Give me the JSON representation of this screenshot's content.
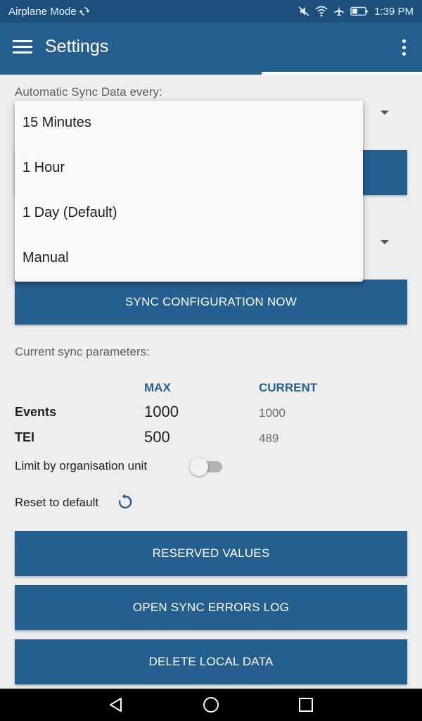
{
  "status_bar": {
    "left_text": "Airplane Mode",
    "time": "1:39 PM"
  },
  "app_bar": {
    "title": "Settings"
  },
  "sync_data": {
    "label": "Automatic Sync Data every:"
  },
  "dropdown": {
    "options": [
      "15 Minutes",
      "1 Hour",
      "1 Day (Default)",
      "Manual"
    ]
  },
  "buttons": {
    "sync_configuration": "SYNC CONFIGURATION NOW",
    "reserved_values": "RESERVED VALUES",
    "open_sync_errors_log": "OPEN SYNC ERRORS LOG",
    "delete_local_data": "DELETE LOCAL DATA"
  },
  "sync_params": {
    "label": "Current sync parameters:",
    "col_max": "MAX",
    "col_current": "CURRENT",
    "rows": [
      {
        "name": "Events",
        "max": "1000",
        "current": "1000"
      },
      {
        "name": "TEI",
        "max": "500",
        "current": "489"
      }
    ],
    "limit_label": "Limit by organisation unit",
    "limit_enabled": false,
    "reset_label": "Reset to default"
  },
  "colors": {
    "primary": "#255f8f",
    "status_bar": "#1d4f7d"
  }
}
